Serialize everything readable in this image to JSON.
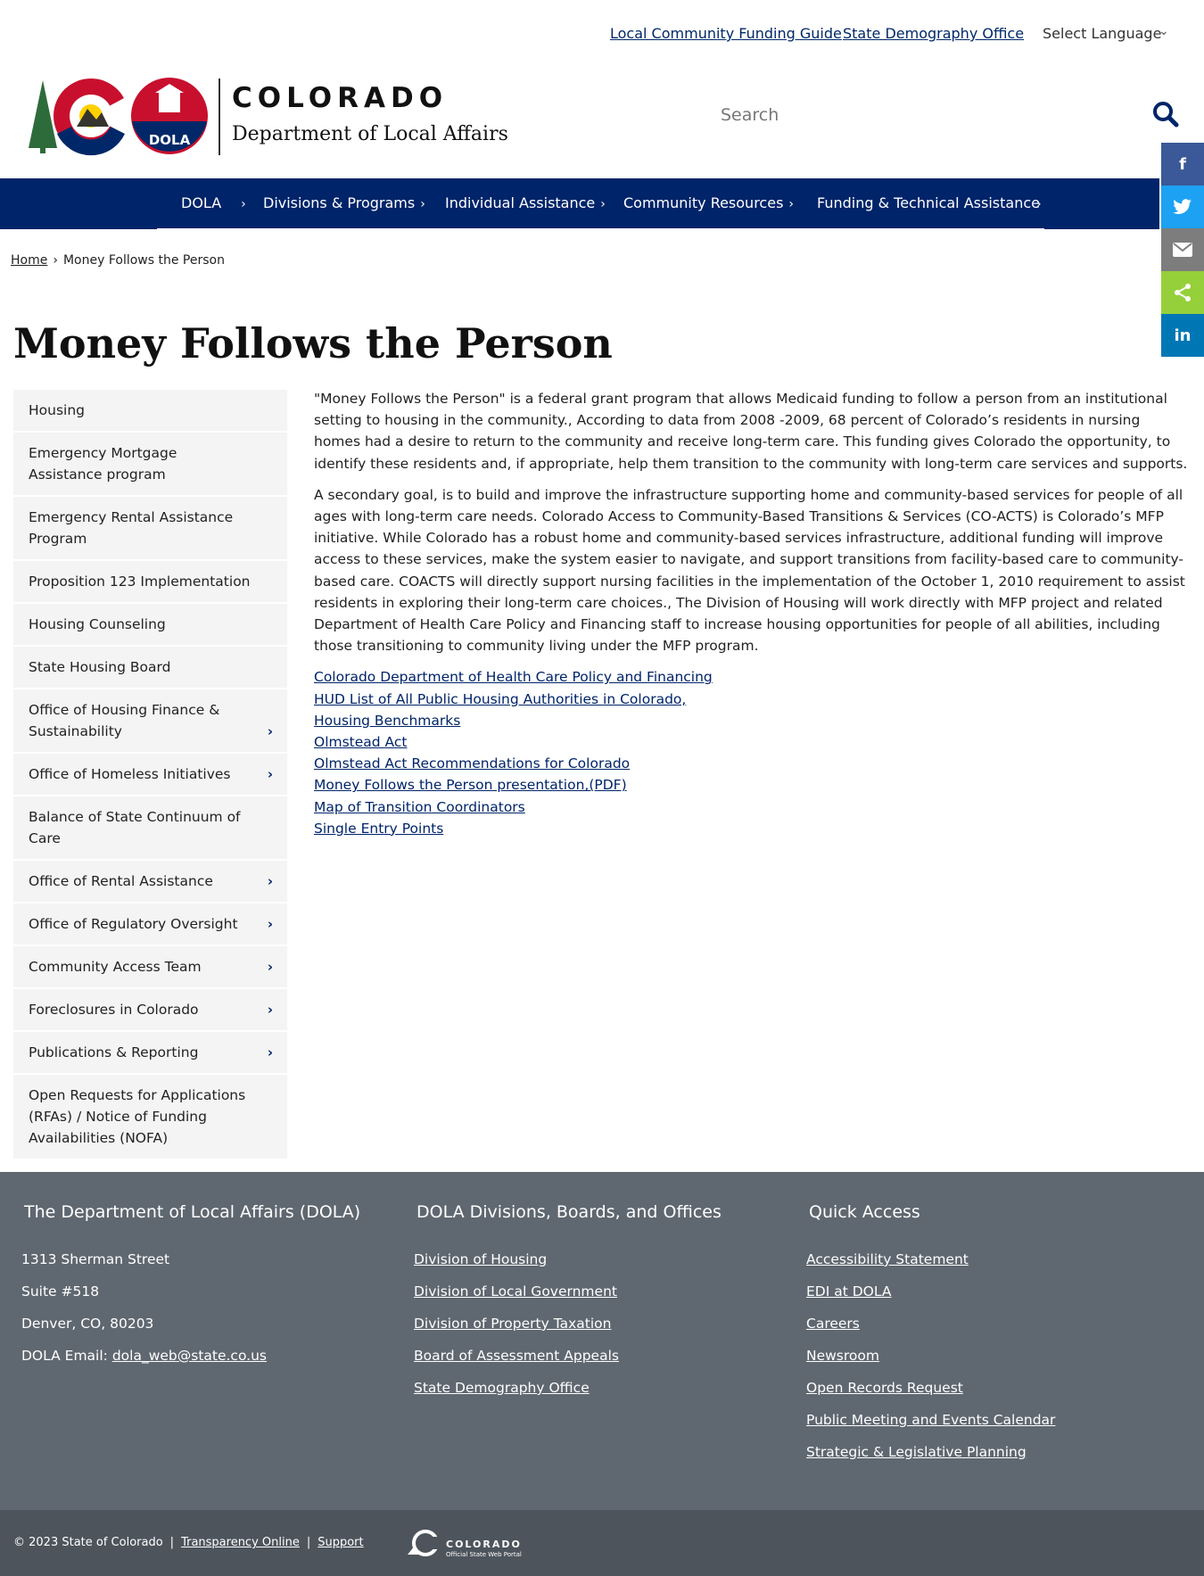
{
  "utility": {
    "link1": "Local Community Funding Guide",
    "link2": "State Demography Office",
    "language": "Select Language"
  },
  "header": {
    "state": "COLORADO",
    "department": "Department of Local Affairs",
    "badge": "DOLA",
    "search_placeholder": "Search"
  },
  "nav": {
    "items": [
      "DOLA",
      "Divisions & Programs",
      "Individual Assistance",
      "Community Resources",
      "Funding & Technical Assistance"
    ]
  },
  "share": {
    "facebook": "f",
    "linkedin": "in"
  },
  "breadcrumb": {
    "home": "Home",
    "current": "Money Follows the Person"
  },
  "page": {
    "title": "Money Follows the Person",
    "para1": "\"Money Follows the Person\" is a federal grant program that allows Medicaid funding to follow a person from an institutional setting to housing in the community., According to data from 2008 -2009, 68 percent of Colorado’s residents in nursing homes had a desire to return to the community and receive long-term care. This funding gives Colorado the opportunity, to identify these residents and, if appropriate, help them transition to the community with long-term care services and supports.",
    "para2": "A secondary goal, is to build and improve the infrastructure supporting home and community-based services for people of all ages with long-term care needs. Colorado Access to Community-Based Transitions & Services (CO-ACTS) is Colorado’s MFP initiative. While Colorado has a robust home and community-based services infrastructure, additional funding will improve access to these services, make the system easier to navigate, and support transitions from facility-based care to community-based care. COACTS will directly support nursing facilities in the implementation of the October 1, 2010 requirement to assist residents in exploring their long-term care choices., The Division of Housing will work directly with MFP project and related Department of Health Care Policy and Financing staff to increase housing opportunities for people of all abilities, including those transitioning to community living under the MFP program.",
    "links": [
      "Colorado Department of Health Care Policy and Financing",
      "HUD List of All Public Housing Authorities in Colorado,",
      "Housing Benchmarks",
      "Olmstead Act",
      "Olmstead Act Recommendations for Colorado",
      "Money Follows the Person presentation,(PDF)",
      "Map of Transition Coordinators",
      "Single Entry Points"
    ]
  },
  "sidebar": {
    "items": [
      "Housing",
      "Emergency Mortgage Assistance program",
      "Emergency Rental Assistance Program",
      "Proposition 123 Implementation",
      "Housing Counseling",
      "State Housing Board",
      "Office of Housing Finance & Sustainability",
      "Office of Homeless Initiatives",
      "Balance of State Continuum of Care",
      "Office of Rental Assistance",
      "Office of Regulatory Oversight",
      "Community Access Team",
      "Foreclosures in Colorado",
      "Publications & Reporting",
      "Open Requests for Applications (RFAs) / Notice of Funding Availabilities (NOFA)"
    ]
  },
  "footer": {
    "col1": {
      "heading": "The Department of Local Affairs (DOLA)",
      "address1": "1313 Sherman Street",
      "address2": "Suite  #518",
      "address3": "Denver, CO, 80203",
      "email_label": "DOLA Email: ",
      "email": "dola_web@state.co.us"
    },
    "col2": {
      "heading": "DOLA Divisions, Boards, and Offices",
      "links": [
        "Division of Housing",
        "Division of Local Government",
        "Division of Property Taxation",
        "Board of Assessment Appeals",
        "State Demography Office"
      ]
    },
    "col3": {
      "heading": "Quick Access",
      "links": [
        "Accessibility Statement",
        "EDI at DOLA",
        "Careers",
        "Newsroom",
        "Open Records Request",
        "Public Meeting and Events Calendar",
        "Strategic & Legislative Planning"
      ]
    }
  },
  "bottom": {
    "copyright": "© 2023 State of Colorado",
    "transparency": "Transparency Online",
    "support": "Support",
    "portal_title": "COLORADO",
    "portal_sub": "Official State Web Portal"
  }
}
